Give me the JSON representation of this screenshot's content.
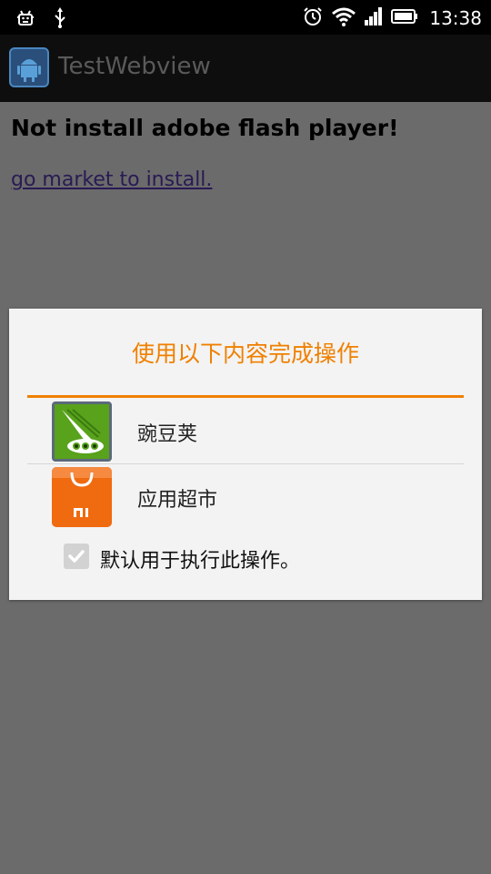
{
  "statusbar": {
    "time": "13:38",
    "icons_left": [
      "android-debug-icon",
      "usb-icon"
    ],
    "icons_right": [
      "alarm-icon",
      "wifi-icon",
      "signal-icon",
      "battery-icon"
    ]
  },
  "actionbar": {
    "title": "TestWebview"
  },
  "page": {
    "heading": "Not install adobe flash player!",
    "link_text": "go market to install."
  },
  "dialog": {
    "title": "使用以下内容完成操作",
    "options": [
      {
        "label": "豌豆荚",
        "icon": "wandoujia-icon"
      },
      {
        "label": "应用超市",
        "icon": "mi-market-icon"
      }
    ],
    "default_label": "默认用于执行此操作。",
    "default_checked": true
  },
  "colors": {
    "accent": "#f08000",
    "scrim": "#6b6b6b",
    "dialog_bg": "#f3f3f3",
    "link": "#2a1a54"
  }
}
